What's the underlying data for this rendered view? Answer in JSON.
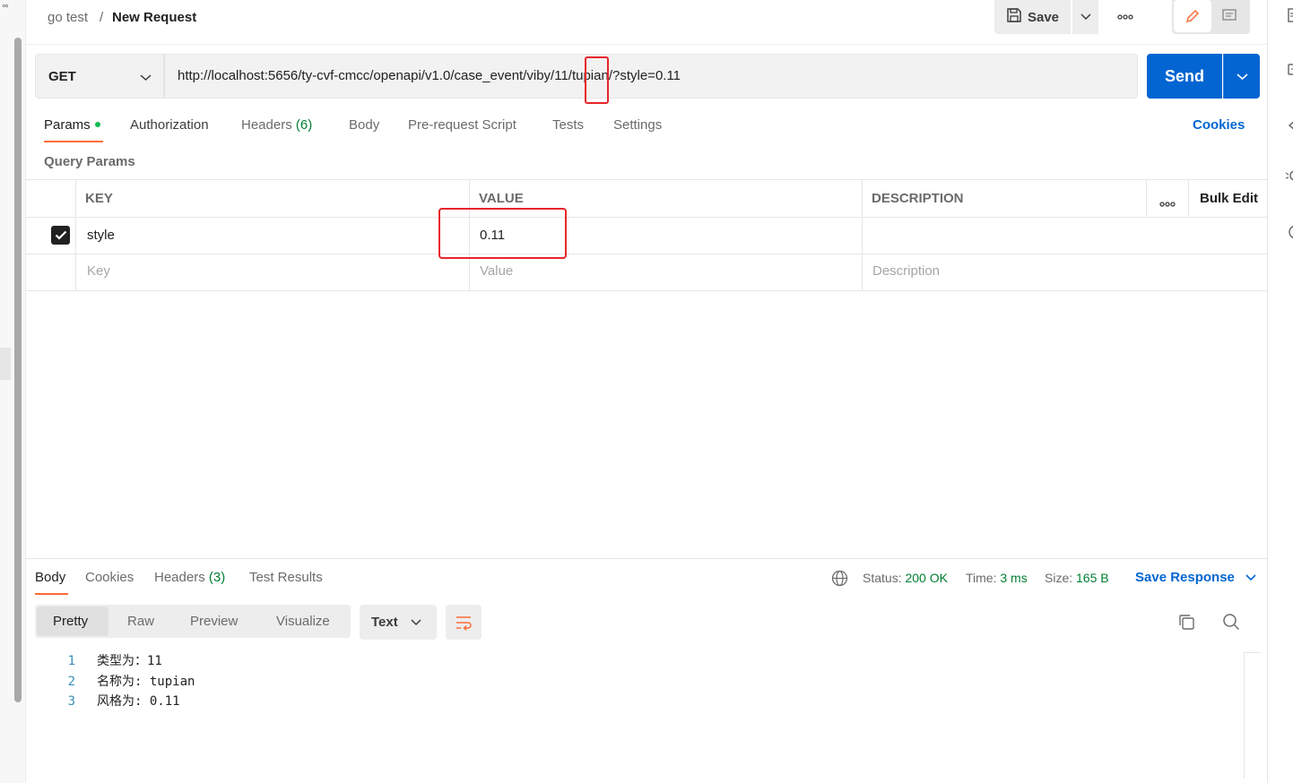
{
  "breadcrumb": {
    "parent": "go test",
    "separator": "/",
    "title": "New Request"
  },
  "header_actions": {
    "save_label": "Save"
  },
  "request": {
    "method": "GET",
    "url": "http://localhost:5656/ty-cvf-cmcc/openapi/v1.0/case_event/viby/11/tupian/?style=0.11",
    "send_label": "Send"
  },
  "request_tabs": [
    {
      "label": "Params",
      "active": true
    },
    {
      "label": "Authorization"
    },
    {
      "label": "Headers",
      "count": "(6)"
    },
    {
      "label": "Body"
    },
    {
      "label": "Pre-request Script"
    },
    {
      "label": "Tests"
    },
    {
      "label": "Settings"
    }
  ],
  "cookies_label": "Cookies",
  "query_params": {
    "title": "Query Params",
    "columns": {
      "key": "KEY",
      "value": "VALUE",
      "description": "DESCRIPTION"
    },
    "bulk_edit_label": "Bulk Edit",
    "rows": [
      {
        "checked": true,
        "key": "style",
        "value": "0.11",
        "description": ""
      }
    ],
    "placeholders": {
      "key": "Key",
      "value": "Value",
      "description": "Description"
    }
  },
  "response": {
    "tabs": [
      {
        "label": "Body",
        "active": true
      },
      {
        "label": "Cookies"
      },
      {
        "label": "Headers",
        "count": "(3)"
      },
      {
        "label": "Test Results"
      }
    ],
    "status_label": "Status:",
    "status_value": "200 OK",
    "time_label": "Time:",
    "time_value": "3 ms",
    "size_label": "Size:",
    "size_value": "165 B",
    "save_response_label": "Save Response",
    "view_modes": [
      "Pretty",
      "Raw",
      "Preview",
      "Visualize"
    ],
    "format": "Text",
    "lines": [
      {
        "n": "1",
        "text": "类型为：11"
      },
      {
        "n": "2",
        "text": "名称为: tupian"
      },
      {
        "n": "3",
        "text": "风格为: 0.11"
      }
    ]
  },
  "colors": {
    "accent": "#ff6c37",
    "primary": "#0265d2",
    "success": "#007f31",
    "highlight": "#e8242a"
  }
}
